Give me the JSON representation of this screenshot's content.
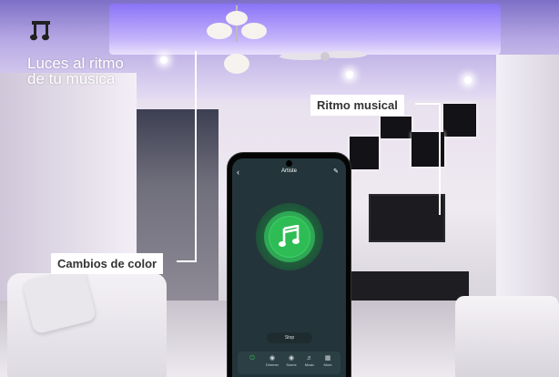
{
  "headline": {
    "line1": "Luces al ritmo",
    "line2": "de tu música"
  },
  "callouts": {
    "rhythm": "Ritmo musical",
    "color": "Cambios de color"
  },
  "phone": {
    "title": "Artiste",
    "stop_label": "Stop",
    "tabs": [
      {
        "label": "",
        "icon": "power-icon",
        "active": true
      },
      {
        "label": "Dimmer",
        "icon": "bulb-icon",
        "active": false
      },
      {
        "label": "Scene",
        "icon": "scene-icon",
        "active": false
      },
      {
        "label": "Music",
        "icon": "music-icon",
        "active": false
      },
      {
        "label": "More",
        "icon": "grid-icon",
        "active": false
      }
    ]
  },
  "colors": {
    "accent_green": "#2ebc55",
    "phone_bg": "#23353a",
    "ceiling_glow": "#8b73ff"
  }
}
